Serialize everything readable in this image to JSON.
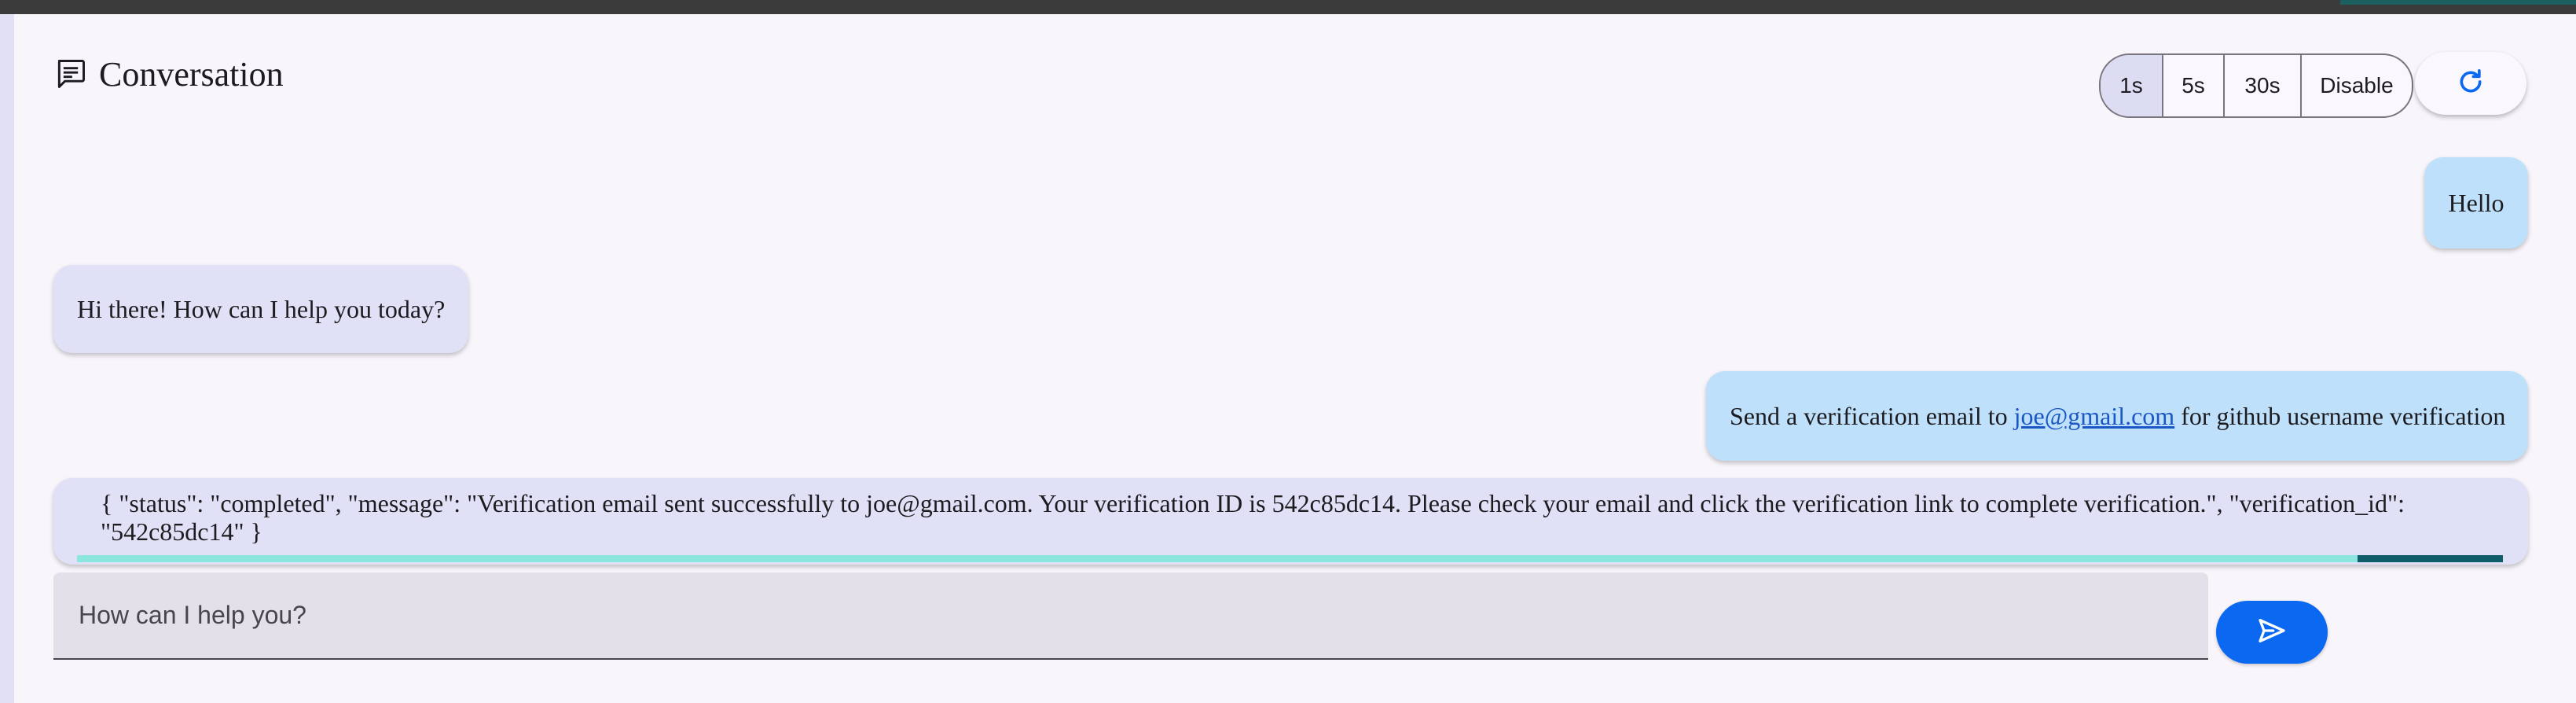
{
  "header": {
    "title": "Conversation",
    "icon": "chat-icon"
  },
  "refresh_controls": {
    "options": [
      {
        "label": "1s",
        "selected": true
      },
      {
        "label": "5s",
        "selected": false
      },
      {
        "label": "30s",
        "selected": false
      },
      {
        "label": "Disable",
        "selected": false
      }
    ],
    "refresh_icon": "refresh-icon"
  },
  "messages": {
    "hello": "Hello",
    "hi": "Hi there! How can I help you today?",
    "verify_prefix": "Send a verification email to ",
    "verify_link": "joe@gmail.com",
    "verify_suffix": " for github username verification",
    "tool_result": "{ \"status\": \"completed\", \"message\": \"Verification email sent successfully to joe@gmail.com. Your verification ID is 542c85dc14. Please check your email and click the verification link to complete verification.\", \"verification_id\": \"542c85dc14\" }"
  },
  "progress": {
    "fraction": 0.94
  },
  "composer": {
    "placeholder": "How can I help you?",
    "send_icon": "send-icon"
  },
  "colors": {
    "user_bubble": "#bfe0fa",
    "assistant_bubble": "#e0e0f6",
    "accent": "#0b68f0"
  }
}
